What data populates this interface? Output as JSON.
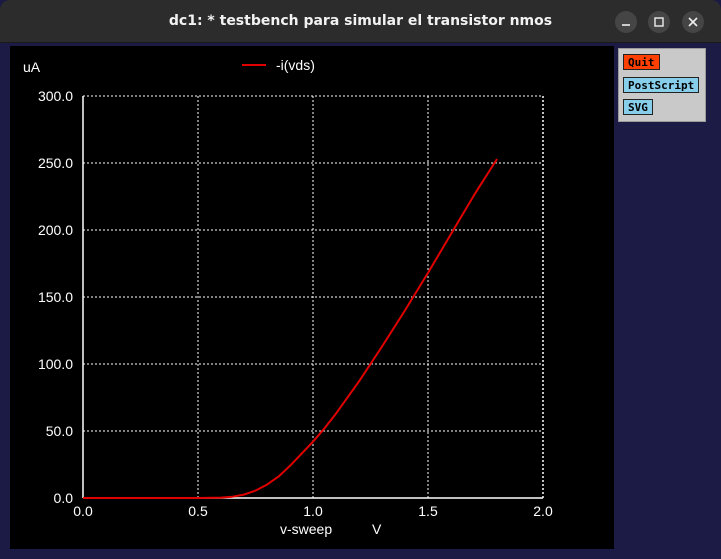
{
  "window": {
    "title": "dc1: * testbench para simular el transistor nmos",
    "controls": [
      "minimize-icon",
      "maximize-icon",
      "close-icon"
    ]
  },
  "sidebar": {
    "buttons": [
      {
        "label": "Quit",
        "color": "#ff4000"
      },
      {
        "label": "PostScript",
        "color": "#87ceeb"
      },
      {
        "label": "SVG",
        "color": "#87ceeb"
      }
    ]
  },
  "plot": {
    "background": "#000000",
    "grid_color": "#ffffff",
    "trace_color": "#e00000"
  },
  "chart_data": {
    "type": "line",
    "ylabel": "uA",
    "xlabel": "v-sweep",
    "xunit": "V",
    "xlim": [
      0.0,
      2.0
    ],
    "ylim": [
      0.0,
      300.0
    ],
    "xticks": [
      "0.0",
      "0.5",
      "1.0",
      "1.5",
      "2.0"
    ],
    "yticks": [
      "0.0",
      "50.0",
      "100.0",
      "150.0",
      "200.0",
      "250.0",
      "300.0"
    ],
    "grid": true,
    "legend_position": "top-center",
    "series": [
      {
        "name": "-i(vds)",
        "x": [
          0.0,
          0.5,
          0.6,
          0.65,
          0.7,
          0.75,
          0.8,
          0.85,
          0.9,
          0.95,
          1.0,
          1.05,
          1.1,
          1.2,
          1.3,
          1.4,
          1.5,
          1.6,
          1.7,
          1.8
        ],
        "y": [
          0.0,
          0.0,
          0.3,
          1.0,
          2.5,
          5.5,
          10.0,
          16.0,
          24.0,
          33.0,
          42.0,
          52.0,
          63.0,
          87.0,
          113.0,
          140.0,
          168.0,
          197.0,
          226.0,
          253.0
        ]
      }
    ]
  }
}
